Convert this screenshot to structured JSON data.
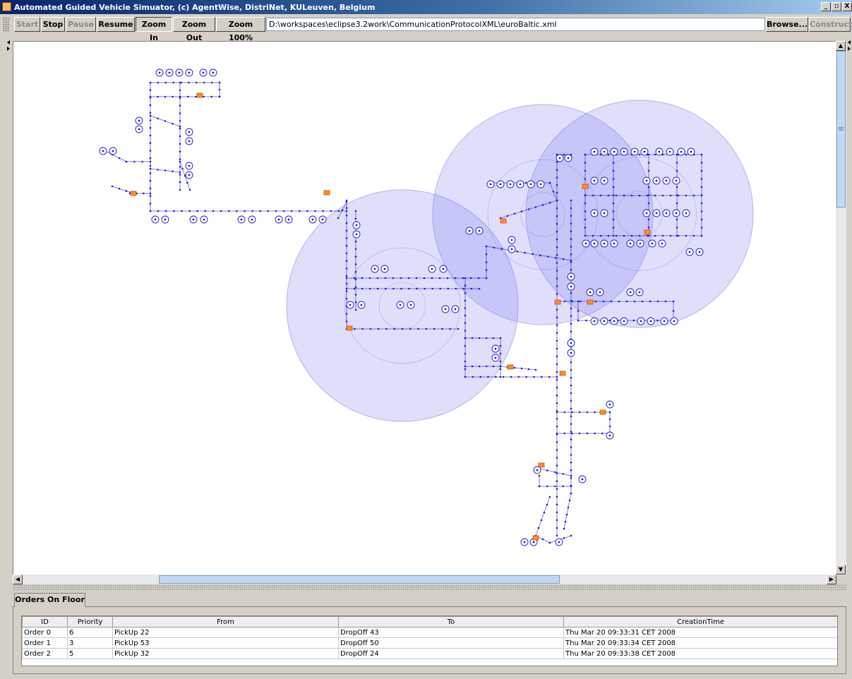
{
  "window": {
    "title": "Automated Guided Vehicle Simuator, (c) AgentWise, DistriNet, KULeuven, Belgium",
    "controls": {
      "minimize": "_",
      "maximize": "▫",
      "close": "X"
    }
  },
  "toolbar": {
    "start": "Start",
    "stop": "Stop",
    "pause": "Pause",
    "resume": "Resume",
    "zoom_in": "Zoom In",
    "zoom_out": "Zoom Out",
    "zoom_100": "Zoom 100%",
    "file_path": "D:\\workspaces\\eclipse3.2work\\CommunicationProtocolXML\\euroBaltic.xml",
    "browse": "Browse...",
    "construct": "Construct"
  },
  "colors": {
    "network": "#1c1cd0",
    "range_circle": "rgba(110,110,240,0.22)",
    "vehicle": "#ff8c2e"
  },
  "icons": {
    "scroll_up": "▲",
    "scroll_down": "▼",
    "scroll_left": "◀",
    "scroll_right": "▶",
    "thumb_grip": "≡"
  },
  "orders_panel": {
    "tab_label": "Orders On Floor",
    "columns": [
      "ID",
      "Priority",
      "From",
      "To",
      "CreationTime"
    ],
    "rows": [
      [
        "Order 0",
        "6",
        "PickUp 22",
        "DropOff 43",
        "Thu Mar 20 09:33:31 CET 2008"
      ],
      [
        "Order 1",
        "3",
        "PickUp 53",
        "DropOff 50",
        "Thu Mar 20 09:33:34 CET 2008"
      ],
      [
        "Order 2",
        "5",
        "PickUp 32",
        "DropOff 24",
        "Thu Mar 20 09:33:38 CET 2008"
      ]
    ]
  }
}
